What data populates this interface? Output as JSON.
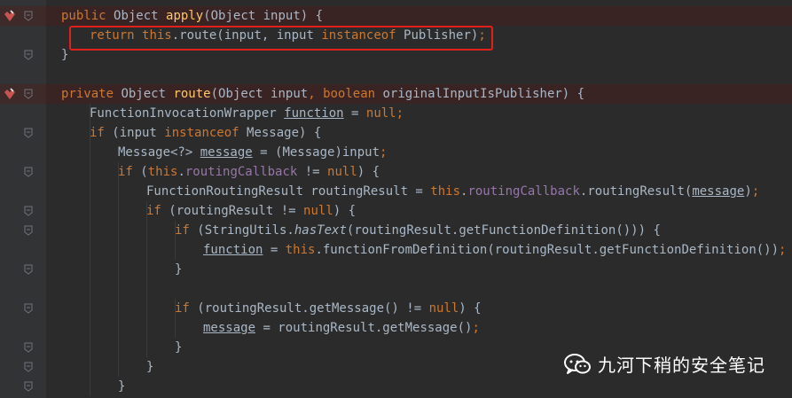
{
  "editor": {
    "lines": [
      {
        "gutter": {
          "breakpoint": true,
          "fold": true
        },
        "indent": 1,
        "tokens": [
          {
            "t": "public",
            "c": "kw"
          },
          {
            "t": " "
          },
          {
            "t": "Object"
          },
          {
            "t": " "
          },
          {
            "t": "apply",
            "c": "fn"
          },
          {
            "t": "(Object input) {"
          }
        ]
      },
      {
        "gutter": {
          "breakpoint": false,
          "fold": false
        },
        "indent": 2,
        "tokens": [
          {
            "t": "return",
            "c": "kw"
          },
          {
            "t": " "
          },
          {
            "t": "this",
            "c": "kw"
          },
          {
            "t": ".route(input, input "
          },
          {
            "t": "instanceof",
            "c": "kw"
          },
          {
            "t": " Publisher)"
          },
          {
            "t": ";",
            "c": "kw"
          }
        ]
      },
      {
        "gutter": {
          "breakpoint": false,
          "fold": true
        },
        "indent": 1,
        "tokens": [
          {
            "t": "}"
          }
        ]
      },
      {
        "gutter": {
          "breakpoint": false,
          "fold": false
        },
        "indent": 0,
        "tokens": []
      },
      {
        "gutter": {
          "breakpoint": true,
          "fold": true
        },
        "indent": 1,
        "tokens": [
          {
            "t": "private",
            "c": "kw"
          },
          {
            "t": " Object "
          },
          {
            "t": "route",
            "c": "fn"
          },
          {
            "t": "(Object input"
          },
          {
            "t": ",",
            "c": "kw"
          },
          {
            "t": " "
          },
          {
            "t": "boolean",
            "c": "kw"
          },
          {
            "t": " originalInputIsPublisher) {"
          }
        ]
      },
      {
        "gutter": {
          "breakpoint": false,
          "fold": false
        },
        "indent": 2,
        "tokens": [
          {
            "t": "FunctionInvocationWrapper "
          },
          {
            "t": "function",
            "c": "reassigned"
          },
          {
            "t": " = "
          },
          {
            "t": "null",
            "c": "kw"
          },
          {
            "t": ";",
            "c": "kw"
          }
        ]
      },
      {
        "gutter": {
          "breakpoint": false,
          "fold": true
        },
        "indent": 2,
        "tokens": [
          {
            "t": "if",
            "c": "kw"
          },
          {
            "t": " (input "
          },
          {
            "t": "instanceof",
            "c": "kw"
          },
          {
            "t": " Message) {"
          }
        ]
      },
      {
        "gutter": {
          "breakpoint": false,
          "fold": false
        },
        "indent": 3,
        "tokens": [
          {
            "t": "Message<?> "
          },
          {
            "t": "message",
            "c": "reassigned"
          },
          {
            "t": " = (Message)input"
          },
          {
            "t": ";",
            "c": "kw"
          }
        ]
      },
      {
        "gutter": {
          "breakpoint": false,
          "fold": true
        },
        "indent": 3,
        "tokens": [
          {
            "t": "if",
            "c": "kw"
          },
          {
            "t": " ("
          },
          {
            "t": "this",
            "c": "kw"
          },
          {
            "t": "."
          },
          {
            "t": "routingCallback",
            "c": "field"
          },
          {
            "t": " != "
          },
          {
            "t": "null",
            "c": "kw"
          },
          {
            "t": ") {"
          }
        ]
      },
      {
        "gutter": {
          "breakpoint": false,
          "fold": false
        },
        "indent": 4,
        "tokens": [
          {
            "t": "FunctionRoutingResult routingResult = "
          },
          {
            "t": "this",
            "c": "kw"
          },
          {
            "t": "."
          },
          {
            "t": "routingCallback",
            "c": "field"
          },
          {
            "t": ".routingResult("
          },
          {
            "t": "message",
            "c": "reassigned"
          },
          {
            "t": ")"
          },
          {
            "t": ";",
            "c": "kw"
          }
        ]
      },
      {
        "gutter": {
          "breakpoint": false,
          "fold": true
        },
        "indent": 4,
        "tokens": [
          {
            "t": "if",
            "c": "kw"
          },
          {
            "t": " (routingResult != "
          },
          {
            "t": "null",
            "c": "kw"
          },
          {
            "t": ") {"
          }
        ]
      },
      {
        "gutter": {
          "breakpoint": false,
          "fold": true
        },
        "indent": 5,
        "tokens": [
          {
            "t": "if",
            "c": "kw"
          },
          {
            "t": " (StringUtils."
          },
          {
            "t": "hasText",
            "c": "static-call"
          },
          {
            "t": "(routingResult.getFunctionDefinition())) {"
          }
        ]
      },
      {
        "gutter": {
          "breakpoint": false,
          "fold": false
        },
        "indent": 6,
        "tokens": [
          {
            "t": "function",
            "c": "reassigned"
          },
          {
            "t": " = "
          },
          {
            "t": "this",
            "c": "kw"
          },
          {
            "t": ".functionFromDefinition(routingResult.getFunctionDefinition())"
          },
          {
            "t": ";",
            "c": "kw"
          }
        ]
      },
      {
        "gutter": {
          "breakpoint": false,
          "fold": true
        },
        "indent": 5,
        "tokens": [
          {
            "t": "}"
          }
        ]
      },
      {
        "gutter": {
          "breakpoint": false,
          "fold": false
        },
        "indent": 0,
        "tokens": []
      },
      {
        "gutter": {
          "breakpoint": false,
          "fold": true
        },
        "indent": 5,
        "tokens": [
          {
            "t": "if",
            "c": "kw"
          },
          {
            "t": " (routingResult.getMessage() != "
          },
          {
            "t": "null",
            "c": "kw"
          },
          {
            "t": ") {"
          }
        ]
      },
      {
        "gutter": {
          "breakpoint": false,
          "fold": false
        },
        "indent": 6,
        "tokens": [
          {
            "t": "message",
            "c": "reassigned"
          },
          {
            "t": " = routingResult.getMessage()"
          },
          {
            "t": ";",
            "c": "kw"
          }
        ]
      },
      {
        "gutter": {
          "breakpoint": false,
          "fold": true
        },
        "indent": 5,
        "tokens": [
          {
            "t": "}"
          }
        ]
      },
      {
        "gutter": {
          "breakpoint": false,
          "fold": true
        },
        "indent": 4,
        "tokens": [
          {
            "t": "}"
          }
        ]
      },
      {
        "gutter": {
          "breakpoint": false,
          "fold": true
        },
        "indent": 3,
        "tokens": [
          {
            "t": "}"
          }
        ]
      }
    ]
  },
  "watermark": {
    "icon": "wechat-icon",
    "text": "九河下稍的安全笔记"
  },
  "colors": {
    "background": "#2b2b2b",
    "keyword": "#cc7832",
    "method": "#ffc66d",
    "field": "#9876aa",
    "text": "#a9b7c6",
    "highlight_box": "#e0201b",
    "breakpoint": "#c75450"
  }
}
